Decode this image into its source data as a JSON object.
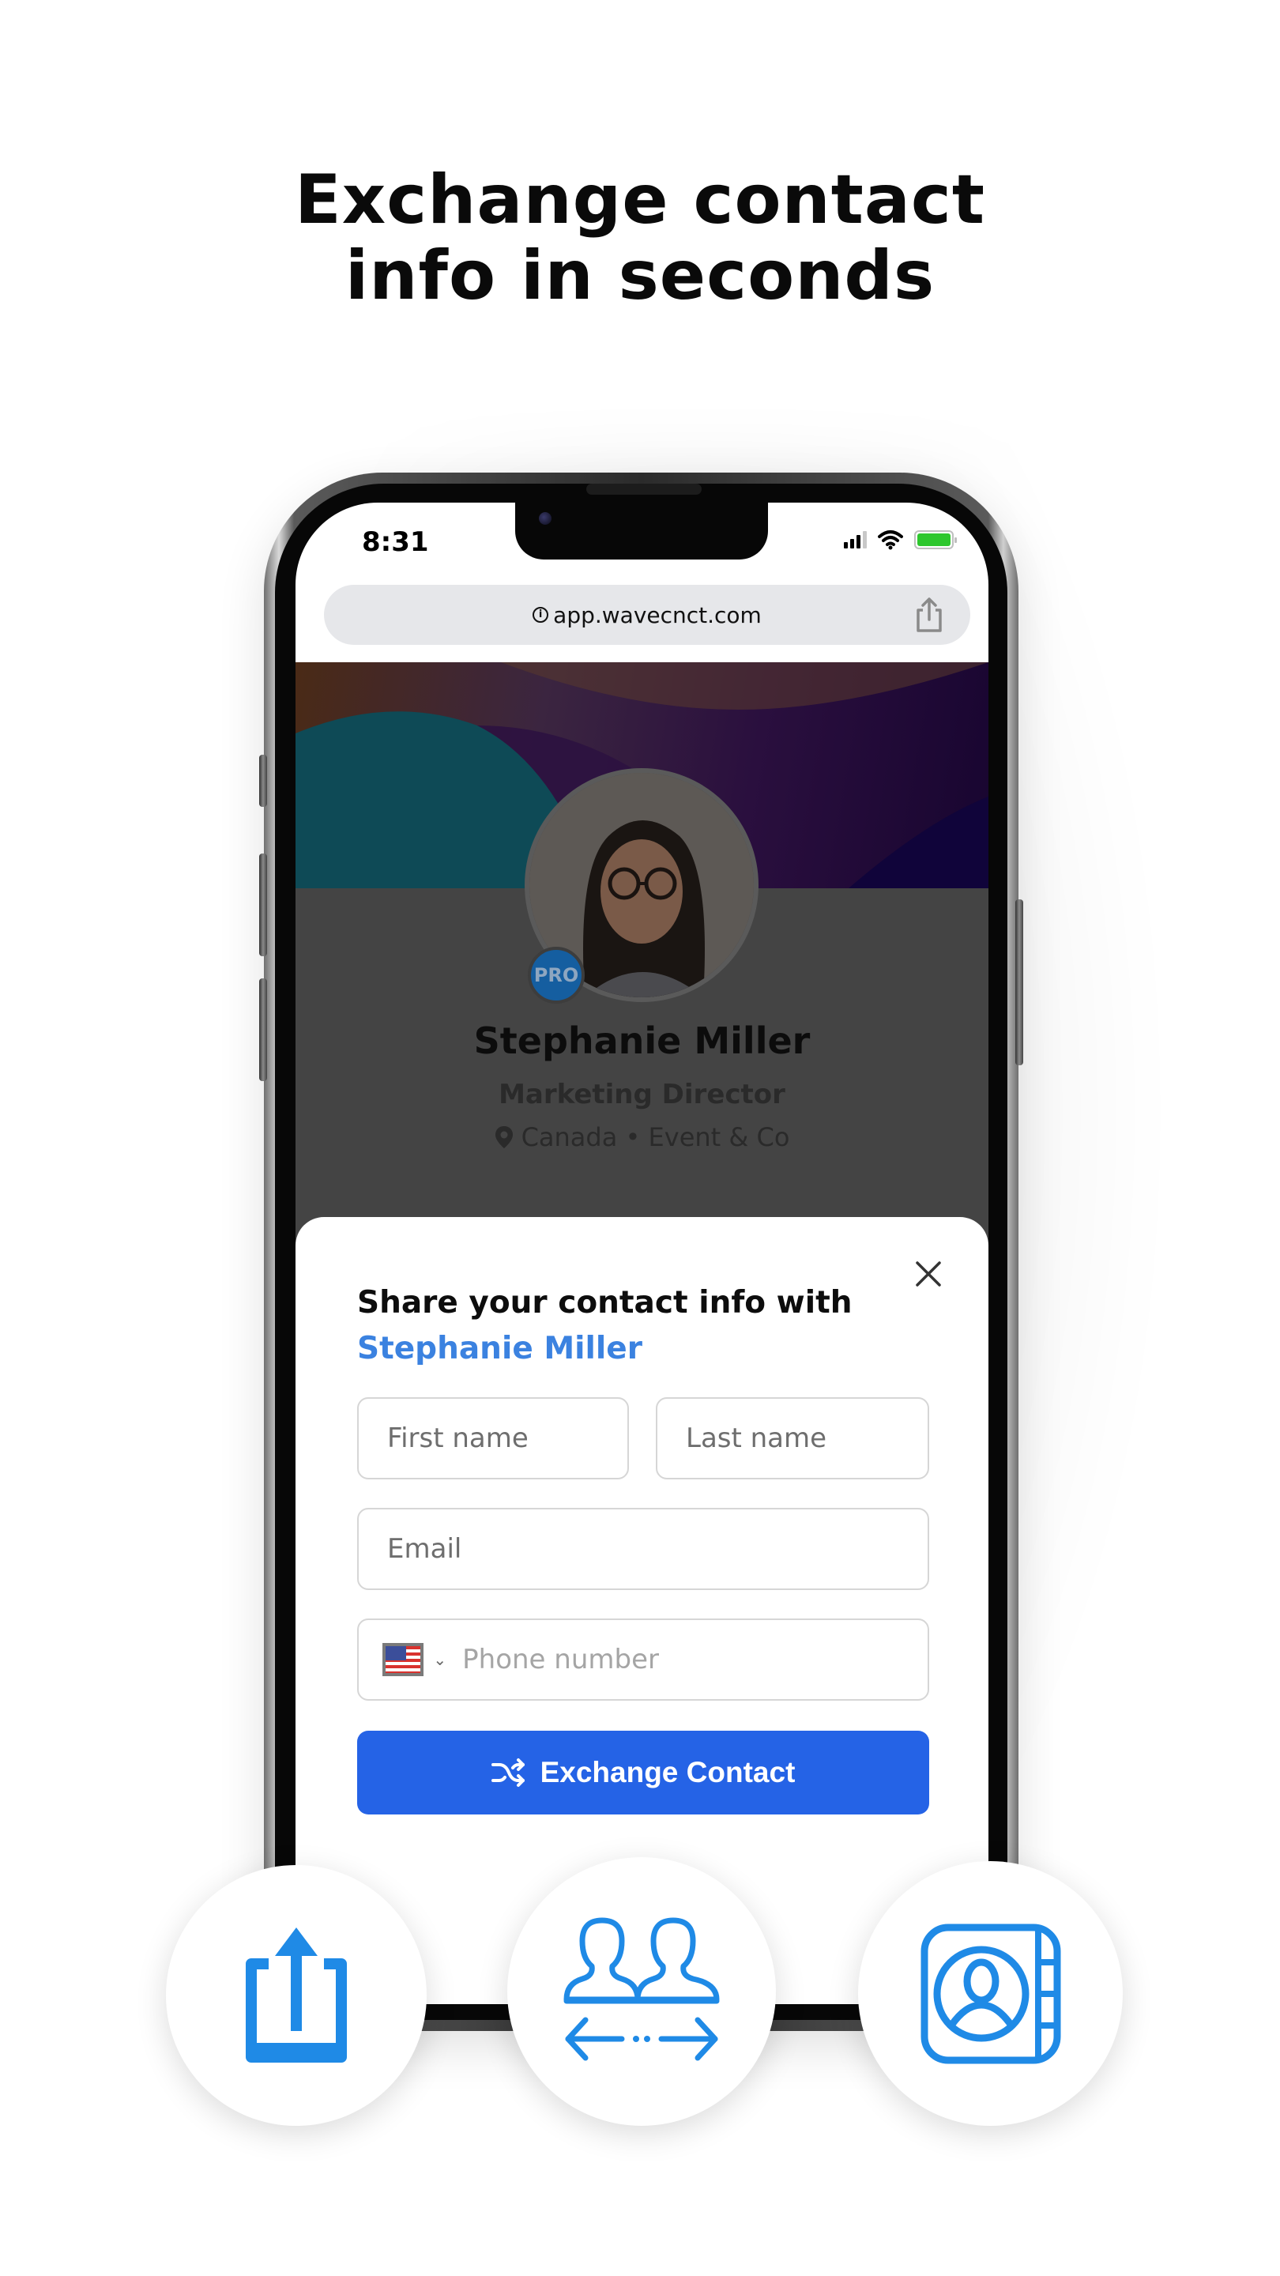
{
  "headline": {
    "line1": "Exchange contact",
    "line2": "info in seconds"
  },
  "status_bar": {
    "time": "8:31",
    "battery_level": 1.0
  },
  "browser": {
    "url": "app.wavecnct.com",
    "info_icon": "info-icon",
    "share_icon": "share-icon"
  },
  "profile": {
    "badge": "PRO",
    "name": "Stephanie Miller",
    "title": "Marketing Director",
    "location_icon": "map-pin-icon",
    "location": "Canada • Event & Co"
  },
  "sheet": {
    "title": "Share your contact info with",
    "recipient": "Stephanie Miller",
    "close_icon": "close-icon",
    "first_name_placeholder": "First name",
    "last_name_placeholder": "Last name",
    "email_placeholder": "Email",
    "phone_country": "US",
    "phone_placeholder": "Phone number",
    "submit_label": "Exchange Contact",
    "submit_icon": "shuffle-icon"
  },
  "features": [
    {
      "icon": "share-upload-icon"
    },
    {
      "icon": "people-exchange-icon"
    },
    {
      "icon": "contact-book-icon"
    }
  ],
  "colors": {
    "accent": "#2563e6",
    "recipient_link": "#3b82e0",
    "icon_blue": "#1f8ae6",
    "battery_green": "#2ec72e"
  }
}
